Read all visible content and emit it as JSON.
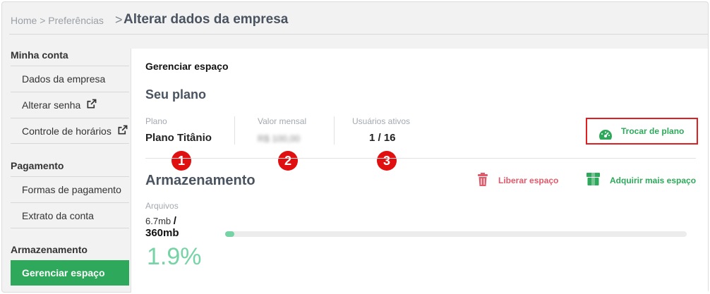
{
  "breadcrumb": {
    "text": "Home > Preferências",
    "separator": ">",
    "title": "Alterar dados da empresa"
  },
  "sidebar": {
    "sections": [
      {
        "title": "Minha conta",
        "items": [
          "Dados da empresa",
          "Alterar senha",
          "Controle de horários"
        ]
      },
      {
        "title": "Pagamento",
        "items": [
          "Formas de pagamento",
          "Extrato da conta"
        ]
      },
      {
        "title": "Armazenamento",
        "items": [
          "Gerenciar espaço"
        ]
      }
    ],
    "external_icon": "external-link-icon",
    "active_item": "Gerenciar espaço"
  },
  "main": {
    "title": "Gerenciar espaço",
    "plan_heading": "Seu plano",
    "plan": {
      "label": "Plano",
      "value": "Plano Titânio"
    },
    "monthly": {
      "label": "Valor mensal",
      "value": "R$ 100,00"
    },
    "users": {
      "label": "Usuários ativos",
      "value": "1 / 16"
    },
    "badges": [
      "1",
      "2",
      "3"
    ],
    "change_plan_button": {
      "label": "Trocar de plano",
      "icon": "speedometer-icon"
    },
    "storage_heading": "Armazenamento",
    "free_space_button": {
      "label": "Liberar espaço",
      "icon": "trash-icon"
    },
    "buy_space_button": {
      "label": "Adquirir mais espaço",
      "icon": "box-icon"
    },
    "files_label": "Arquivos",
    "used": "6.7mb",
    "used_sep": "/",
    "total": "360mb",
    "percent_text": "1.9%",
    "usage_fraction": 0.019
  },
  "colors": {
    "accent_green": "#2ea85a",
    "light_green": "#75d3a5",
    "danger": "#e05a6a",
    "badge_red": "#e01010"
  }
}
